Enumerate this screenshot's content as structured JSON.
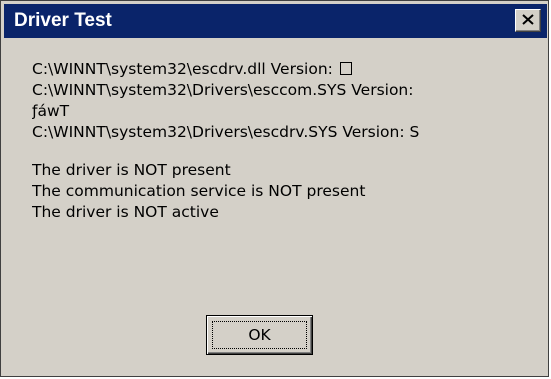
{
  "window": {
    "title": "Driver Test",
    "close_icon": "close-x-icon"
  },
  "message": {
    "lines": [
      {
        "path": "C:\\WINNT\\system32\\escdrv.dll Version:",
        "value_glyph": "box"
      },
      {
        "path": "C:\\WINNT\\system32\\Drivers\\esccom.SYS Version:"
      },
      {
        "path": "ƒáwT"
      },
      {
        "path": "C:\\WINNT\\system32\\Drivers\\escdrv.SYS Version:",
        "value": "S"
      }
    ],
    "status": [
      "The driver is NOT present",
      "The communication service is NOT present",
      "The driver is NOT active"
    ]
  },
  "buttons": {
    "ok_label": "OK"
  },
  "colors": {
    "titlebar": "#0a246a",
    "dialog_bg": "#d4d0c8"
  }
}
